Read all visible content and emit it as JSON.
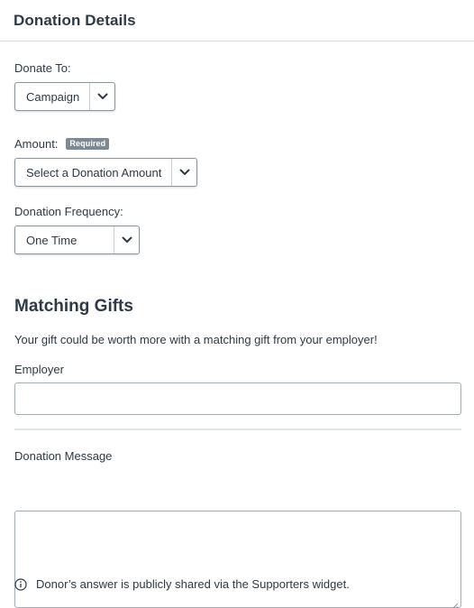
{
  "header": {
    "title": "Donation Details"
  },
  "donate_to": {
    "label": "Donate To:",
    "selected": "Campaign"
  },
  "amount": {
    "label": "Amount:",
    "badge": "Required",
    "selected": "Select a Donation Amount"
  },
  "frequency": {
    "label": "Donation Frequency:",
    "selected": "One Time"
  },
  "matching": {
    "title": "Matching Gifts",
    "description": "Your gift could be worth more with a matching gift from your employer!",
    "employer_label": "Employer",
    "employer_value": "",
    "employer_placeholder": ""
  },
  "message": {
    "label": "Donation Message",
    "value": "",
    "note": "Donor’s answer is publicly shared via the Supporters widget."
  },
  "icons": {
    "select_chevron": "chevron-down-icon",
    "note_icon": "info-icon",
    "resize": "resize-grip-icon"
  },
  "colors": {
    "text": "#2e3a46",
    "badge_bg": "#7d8a96",
    "border": "#8a949e",
    "divider": "#e1e4e7"
  }
}
